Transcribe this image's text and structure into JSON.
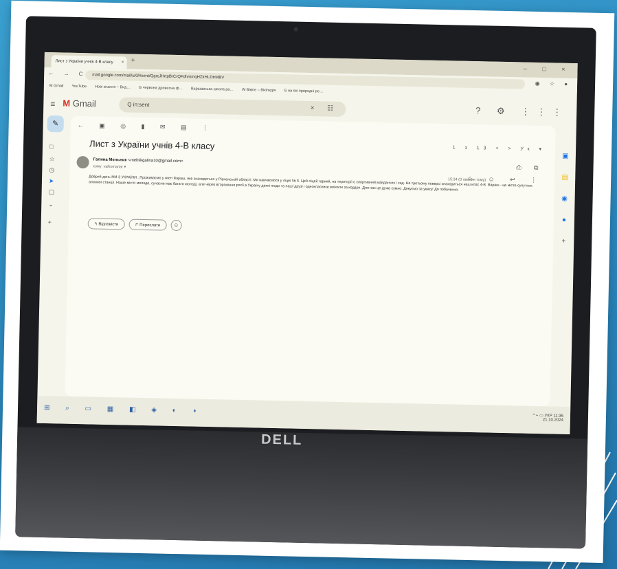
{
  "browser": {
    "tab_title": "Лист з України учнів 4-В класу",
    "tab_close": "×",
    "new_tab": "+",
    "window_controls": "– □ ×",
    "nav_controls": "← → C",
    "url": "mail.google.com/mail/u/0/#sent/QgrcJHrtpBrCrQFdhmmqHZkHLDtrMBV",
    "omni_actions": "◉ ☆ ●",
    "bookmarks": [
      "M Gmail",
      "YouTube",
      "Нові знання – Вид…",
      "G червона древесна ф…",
      "Варшавська школа ра…",
      "W Вікіпе – Вікіпедія",
      "G на які природні ре…"
    ]
  },
  "gmail": {
    "menu_icon": "≡",
    "logo_m": "M",
    "logo_text": "Gmail",
    "search_value": "Q  in:sent",
    "search_actions": "× ☷",
    "top_icons": "? ⚙ ⋮⋮⋮",
    "compose_icon": "✎",
    "rail_icons": [
      "□",
      "☆",
      "◷",
      "➤",
      "▢",
      "⌄",
      "+"
    ],
    "toolbar_icons": "← ▣ ◎ ▮ ✉ ▤ ⋮",
    "pager": "1 з 13   <   >   Ук ▾",
    "subject": "Лист з України учнів 4-В класу",
    "sender_name": "Галина Мельник",
    "sender_email": "<melnikgalina10@gmail.com>",
    "to_me": "кому: valkomariar ▾",
    "time": "15:34 (0 хвилин тому)",
    "print_icons": "⎙ ⧉",
    "msg_actions": "☆ ☺ ↩ ⋮",
    "body": "Добрий день МИ З УКРАЇНИ . Проживаємо у місті Вараш, яке знаходиться у Рівненській області. Ми навчаємося у ліцеї № 5. Цей ліцей гарний, на території є спортивний майданчик і сад. На третьому поверсі знаходиться наш клас 4-В. Вараш - це місто-супутник атомної станції. Наше місто молоде, сучасне має багато молоді, але через вторгнення росії в Україну деякі люди та наші друзі і однокласники виїхали за кордон. Для нас це дуже сумно. Дякуємо за увагу! До побачення.",
    "reply_label": "↰ Відповісти",
    "forward_label": "↱ Переслати",
    "emoji_icon": "☺",
    "side_apps": [
      "▣",
      "▤",
      "◉",
      "●",
      "+"
    ]
  },
  "taskbar": {
    "icons": "⊞ ⌕ ▭ ▦ ◧ ◈ ◐ ◑",
    "tray_left": "^ ⌁ ▭ УКР",
    "time": "11:35",
    "date": "21.10.2024"
  },
  "laptop": {
    "brand": "DELL"
  }
}
